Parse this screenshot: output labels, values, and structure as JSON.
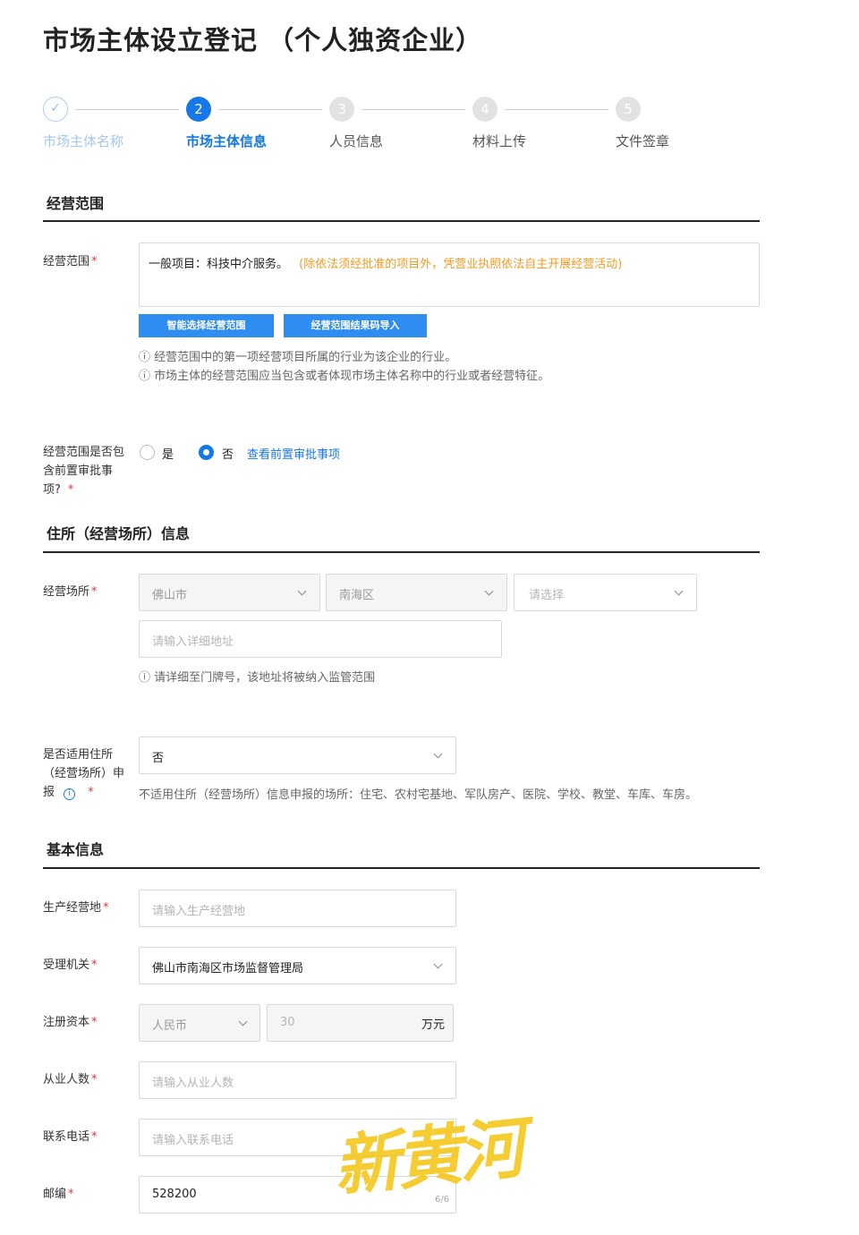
{
  "page": {
    "title": "市场主体设立登记 （个人独资企业）"
  },
  "stepper": {
    "steps": [
      {
        "number": "✓",
        "label": "市场主体名称",
        "state": "done"
      },
      {
        "number": "2",
        "label": "市场主体信息",
        "state": "active"
      },
      {
        "number": "3",
        "label": "人员信息",
        "state": "todo"
      },
      {
        "number": "4",
        "label": "材料上传",
        "state": "todo"
      },
      {
        "number": "5",
        "label": "文件签章",
        "state": "todo"
      }
    ]
  },
  "business_scope": {
    "section_title": "经营范围",
    "label": "经营范围",
    "required_mark": "*",
    "scope_text": "一般项目：科技中介服务。",
    "scope_note": "(除依法须经批准的项目外，凭营业执照依法自主开展经营活动)",
    "btn_smart": "智能选择经营范围",
    "btn_import": "经营范围结果码导入",
    "hint1": "ⓘ 经营范围中的第一项经营项目所属的行业为该企业的行业。",
    "hint2": "ⓘ 市场主体的经营范围应当包含或者体现市场主体名称中的行业或者经营特征。",
    "approval_label_1": "经营范围是否包",
    "approval_label_2": "含前置审批事",
    "approval_label_3": "项?",
    "radio_yes": "是",
    "radio_no": "否",
    "selected": "否",
    "view_link": "查看前置审批事项"
  },
  "address": {
    "section_title": "住所（经营场所）信息",
    "label": "经营场所",
    "city": "佛山市",
    "district": "南海区",
    "street_placeholder": "请选择",
    "detail_placeholder": "请输入详细地址",
    "hint": "ⓘ 请详细至门牌号，该地址将被纳入监管范围",
    "apply_label_1": "是否适用住所",
    "apply_label_2": "（经营场所）申",
    "apply_label_3": "报",
    "apply_value": "否",
    "apply_note": "不适用住所（经营场所）信息申报的场所：住宅、农村宅基地、军队房产、医院、学校、教堂、车库、车房。"
  },
  "basic": {
    "section_title": "基本信息",
    "production_label": "生产经营地",
    "production_placeholder": "请输入生产经营地",
    "authority_label": "受理机关",
    "authority_value": "佛山市南海区市场监督管理局",
    "capital_label": "注册资本",
    "currency": "人民币",
    "capital_value": "30",
    "capital_unit": "万元",
    "staff_label": "从业人数",
    "staff_placeholder": "请输入从业人数",
    "phone_label": "联系电话",
    "phone_placeholder": "请输入联系电话",
    "postcode_label": "邮编",
    "postcode_value": "528200",
    "postcode_count": "6/6"
  },
  "watermark": {
    "text": "新黄河",
    "color": "#f5c518"
  },
  "colors": {
    "accent": "#1677e6",
    "required": "#e63737",
    "note_orange": "#f59a23"
  }
}
